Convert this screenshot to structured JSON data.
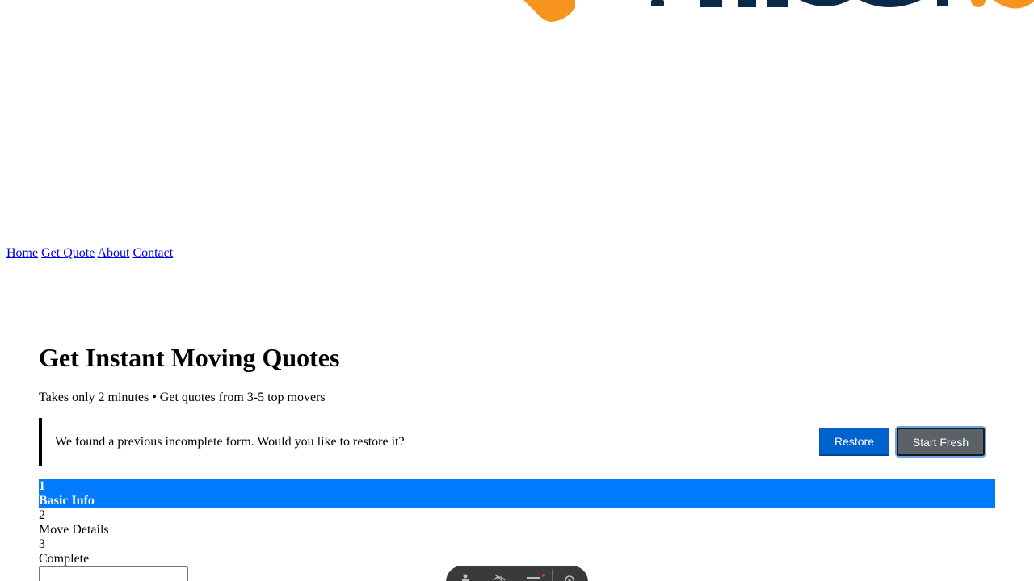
{
  "nav": {
    "items": [
      "Home",
      "Get Quote",
      "About",
      "Contact"
    ]
  },
  "page": {
    "title": "Get Instant Moving Quotes",
    "subtitle": "Takes only 2 minutes • Get quotes from 3-5 top movers"
  },
  "restore_banner": {
    "message": "We found a previous incomplete form. Would you like to restore it?",
    "restore_label": "Restore",
    "start_fresh_label": "Start Fresh"
  },
  "steps": [
    {
      "number": "1",
      "label": "Basic Info",
      "active": true
    },
    {
      "number": "2",
      "label": "Move Details",
      "active": false
    },
    {
      "number": "3",
      "label": "Complete",
      "active": false
    }
  ],
  "colors": {
    "step_active": "#007bff",
    "restore_button": "#0062cc",
    "start_fresh_button": "#5a6268",
    "logo_orange": "#f7941d",
    "logo_navy": "#0b2a4a"
  },
  "icons": {
    "toolbar": [
      "accessibility-icon",
      "no-eye-icon",
      "menu-icon",
      "settings-icon"
    ]
  }
}
